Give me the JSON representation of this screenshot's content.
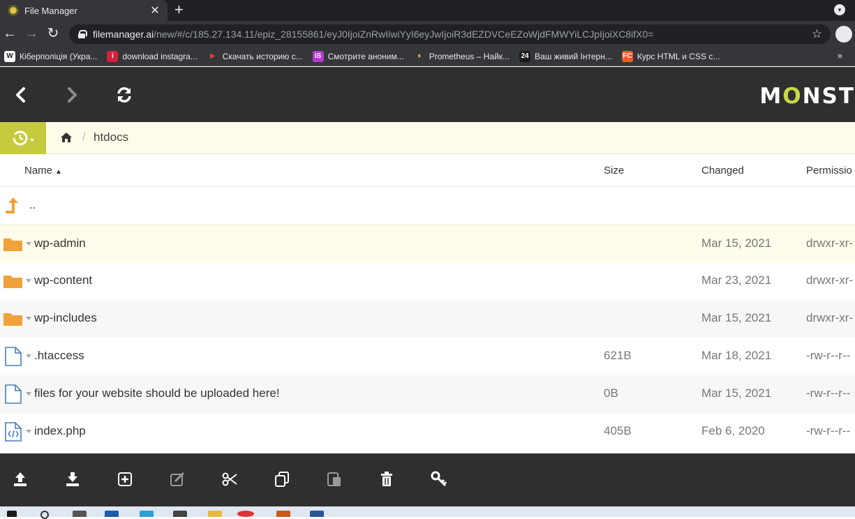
{
  "browser": {
    "tab_title": "File Manager",
    "tab_close": "✕",
    "new_tab": "+",
    "url_host": "filemanager.ai",
    "url_path": "/new/#/c/185.27.134.11/epiz_28155861/eyJ0IjoiZnRwIiwiYyI6eyJwIjoiR3dEZDVCeEZoWjdFMWYiLCJpIjoiXC8ifX0=",
    "bookmarks": [
      {
        "label": "Кіберполіція (Укра...",
        "icon": "W",
        "color": "#ffffff",
        "text_color": "#202124"
      },
      {
        "label": "download instagra...",
        "icon": "i",
        "color": "#d0223a",
        "text_color": "#ffffff"
      },
      {
        "label": "Скачать историю с...",
        "icon": "▶",
        "color": "#35363a",
        "text_color": "#e04040"
      },
      {
        "label": "Смотрите аноним...",
        "icon": "iS",
        "color": "#b23bd1",
        "text_color": "#ffffff"
      },
      {
        "label": "Prometheus – Найк...",
        "icon": "♦",
        "color": "#35363a",
        "text_color": "#c8b04a"
      },
      {
        "label": "Ваш живий Інтерн...",
        "icon": "24",
        "color": "#1b1b1b",
        "text_color": "#ffffff"
      },
      {
        "label": "Курс HTML и CSS с...",
        "icon": "FC",
        "color": "#f15a24",
        "text_color": "#ffffff"
      }
    ],
    "bookmarks_more": "»"
  },
  "header": {
    "brand_prefix": "M",
    "brand_o": "O",
    "brand_suffix": "NST"
  },
  "breadcrumb": {
    "separator": "/",
    "current": "htdocs"
  },
  "columns": {
    "name": "Name",
    "sort_indicator": "▲",
    "size": "Size",
    "changed": "Changed",
    "permissions": "Permissio"
  },
  "parent_row": {
    "label": ".."
  },
  "rows": [
    {
      "type": "folder",
      "name": "wp-admin",
      "size": "",
      "changed": "Mar 15, 2021",
      "perm": "drwxr-xr-"
    },
    {
      "type": "folder",
      "name": "wp-content",
      "size": "",
      "changed": "Mar 23, 2021",
      "perm": "drwxr-xr-"
    },
    {
      "type": "folder",
      "name": "wp-includes",
      "size": "",
      "changed": "Mar 15, 2021",
      "perm": "drwxr-xr-"
    },
    {
      "type": "file",
      "name": ".htaccess",
      "size": "621B",
      "changed": "Mar 18, 2021",
      "perm": "-rw-r--r--"
    },
    {
      "type": "file",
      "name": "files for your website should be uploaded here!",
      "size": "0B",
      "changed": "Mar 15, 2021",
      "perm": "-rw-r--r--"
    },
    {
      "type": "code",
      "name": "index.php",
      "size": "405B",
      "changed": "Feb 6, 2020",
      "perm": "-rw-r--r--"
    }
  ],
  "colors": {
    "accent": "#c6ca3e",
    "folder": "#f0a23a",
    "selected_row": "#fefcea",
    "header_bg": "#2f2f2f"
  },
  "actions": [
    "upload-icon",
    "download-icon",
    "new-item-icon",
    "rename-icon",
    "cut-icon",
    "copy-icon",
    "paste-icon",
    "delete-icon",
    "permissions-key-icon"
  ]
}
